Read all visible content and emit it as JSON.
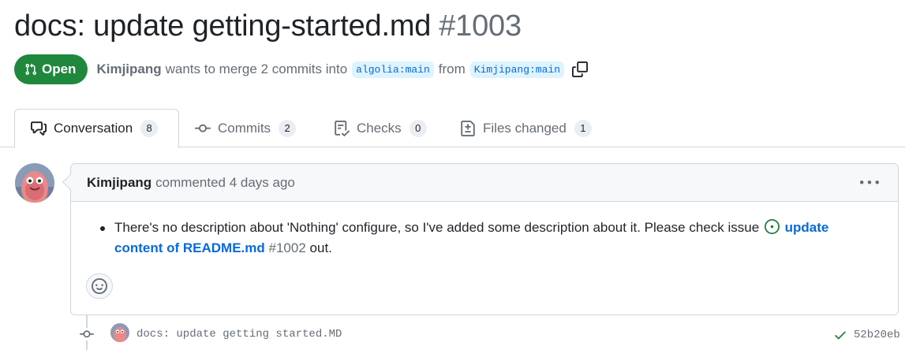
{
  "pr": {
    "title": "docs: update getting-started.md",
    "number": "#1003",
    "state": "Open",
    "author": "Kimjipang",
    "merge_text": "wants to merge 2 commits into",
    "base_branch": "algolia:main",
    "from_text": "from",
    "head_branch": "Kimjipang:main"
  },
  "tabs": [
    {
      "label": "Conversation",
      "count": "8",
      "icon": "comment-discussion-icon"
    },
    {
      "label": "Commits",
      "count": "2",
      "icon": "git-commit-icon"
    },
    {
      "label": "Checks",
      "count": "0",
      "icon": "checklist-icon"
    },
    {
      "label": "Files changed",
      "count": "1",
      "icon": "file-diff-icon"
    }
  ],
  "comment": {
    "author": "Kimjipang",
    "action": "commented 4 days ago",
    "body_text": "There's no description about 'Nothing' configure, so I've added some description about it. Please check issue",
    "issue_link": "update content of README.md",
    "issue_number": "#1002",
    "body_tail": "out."
  },
  "commit": {
    "message": "docs: update getting started.MD",
    "sha": "52b20eb"
  },
  "colors": {
    "open_green": "#1f883d",
    "link_blue": "#0969da",
    "muted": "#656d76",
    "border": "#d0d7de"
  }
}
